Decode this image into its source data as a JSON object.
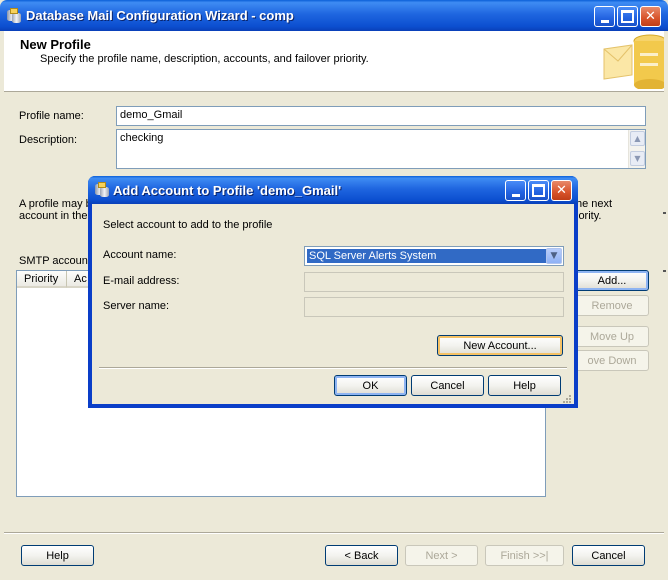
{
  "main_window": {
    "title": "Database Mail Configuration Wizard - comp",
    "header": {
      "title": "New Profile",
      "subtitle": "Specify the profile name, description, accounts, and failover priority."
    },
    "profile_name": {
      "label": "Profile name:",
      "value": "demo_Gmail"
    },
    "description": {
      "label": "Description:",
      "value": "checking"
    },
    "info_text_left_1": "A profile may b",
    "info_text_left_2": "account in the",
    "info_text_right_1": "he next",
    "info_text_right_2": "iority.",
    "smtp_label": "SMTP accoun",
    "smtp_columns": [
      "Priority",
      "Ac"
    ],
    "side_buttons": {
      "add": "Add...",
      "remove": "Remove",
      "move_up": "Move Up",
      "move_down": "ove Down"
    },
    "footer": {
      "help": "Help",
      "back": "< Back",
      "next": "Next >",
      "finish": "Finish >>|",
      "cancel": "Cancel"
    }
  },
  "dialog": {
    "title": "Add Account to Profile 'demo_Gmail'",
    "instruction": "Select account to add to the profile",
    "account_name_label": "Account name:",
    "account_name_value": "SQL Server Alerts System",
    "email_label": "E-mail address:",
    "email_value": "",
    "server_label": "Server name:",
    "server_value": "",
    "new_account": "New Account...",
    "ok": "OK",
    "cancel": "Cancel",
    "help": "Help"
  },
  "icons": {
    "app": "database-mail-icon",
    "minimize": "minimize-icon",
    "maximize": "maximize-icon",
    "close": "close-icon",
    "dropdown": "chevron-down-icon",
    "scroll_up": "scroll-up-icon",
    "scroll_down": "scroll-down-icon"
  },
  "colors": {
    "titlebar": "#0a5fd8",
    "window_face": "#ece9d8",
    "selection": "#316ac5",
    "close_button": "#d8532a"
  }
}
